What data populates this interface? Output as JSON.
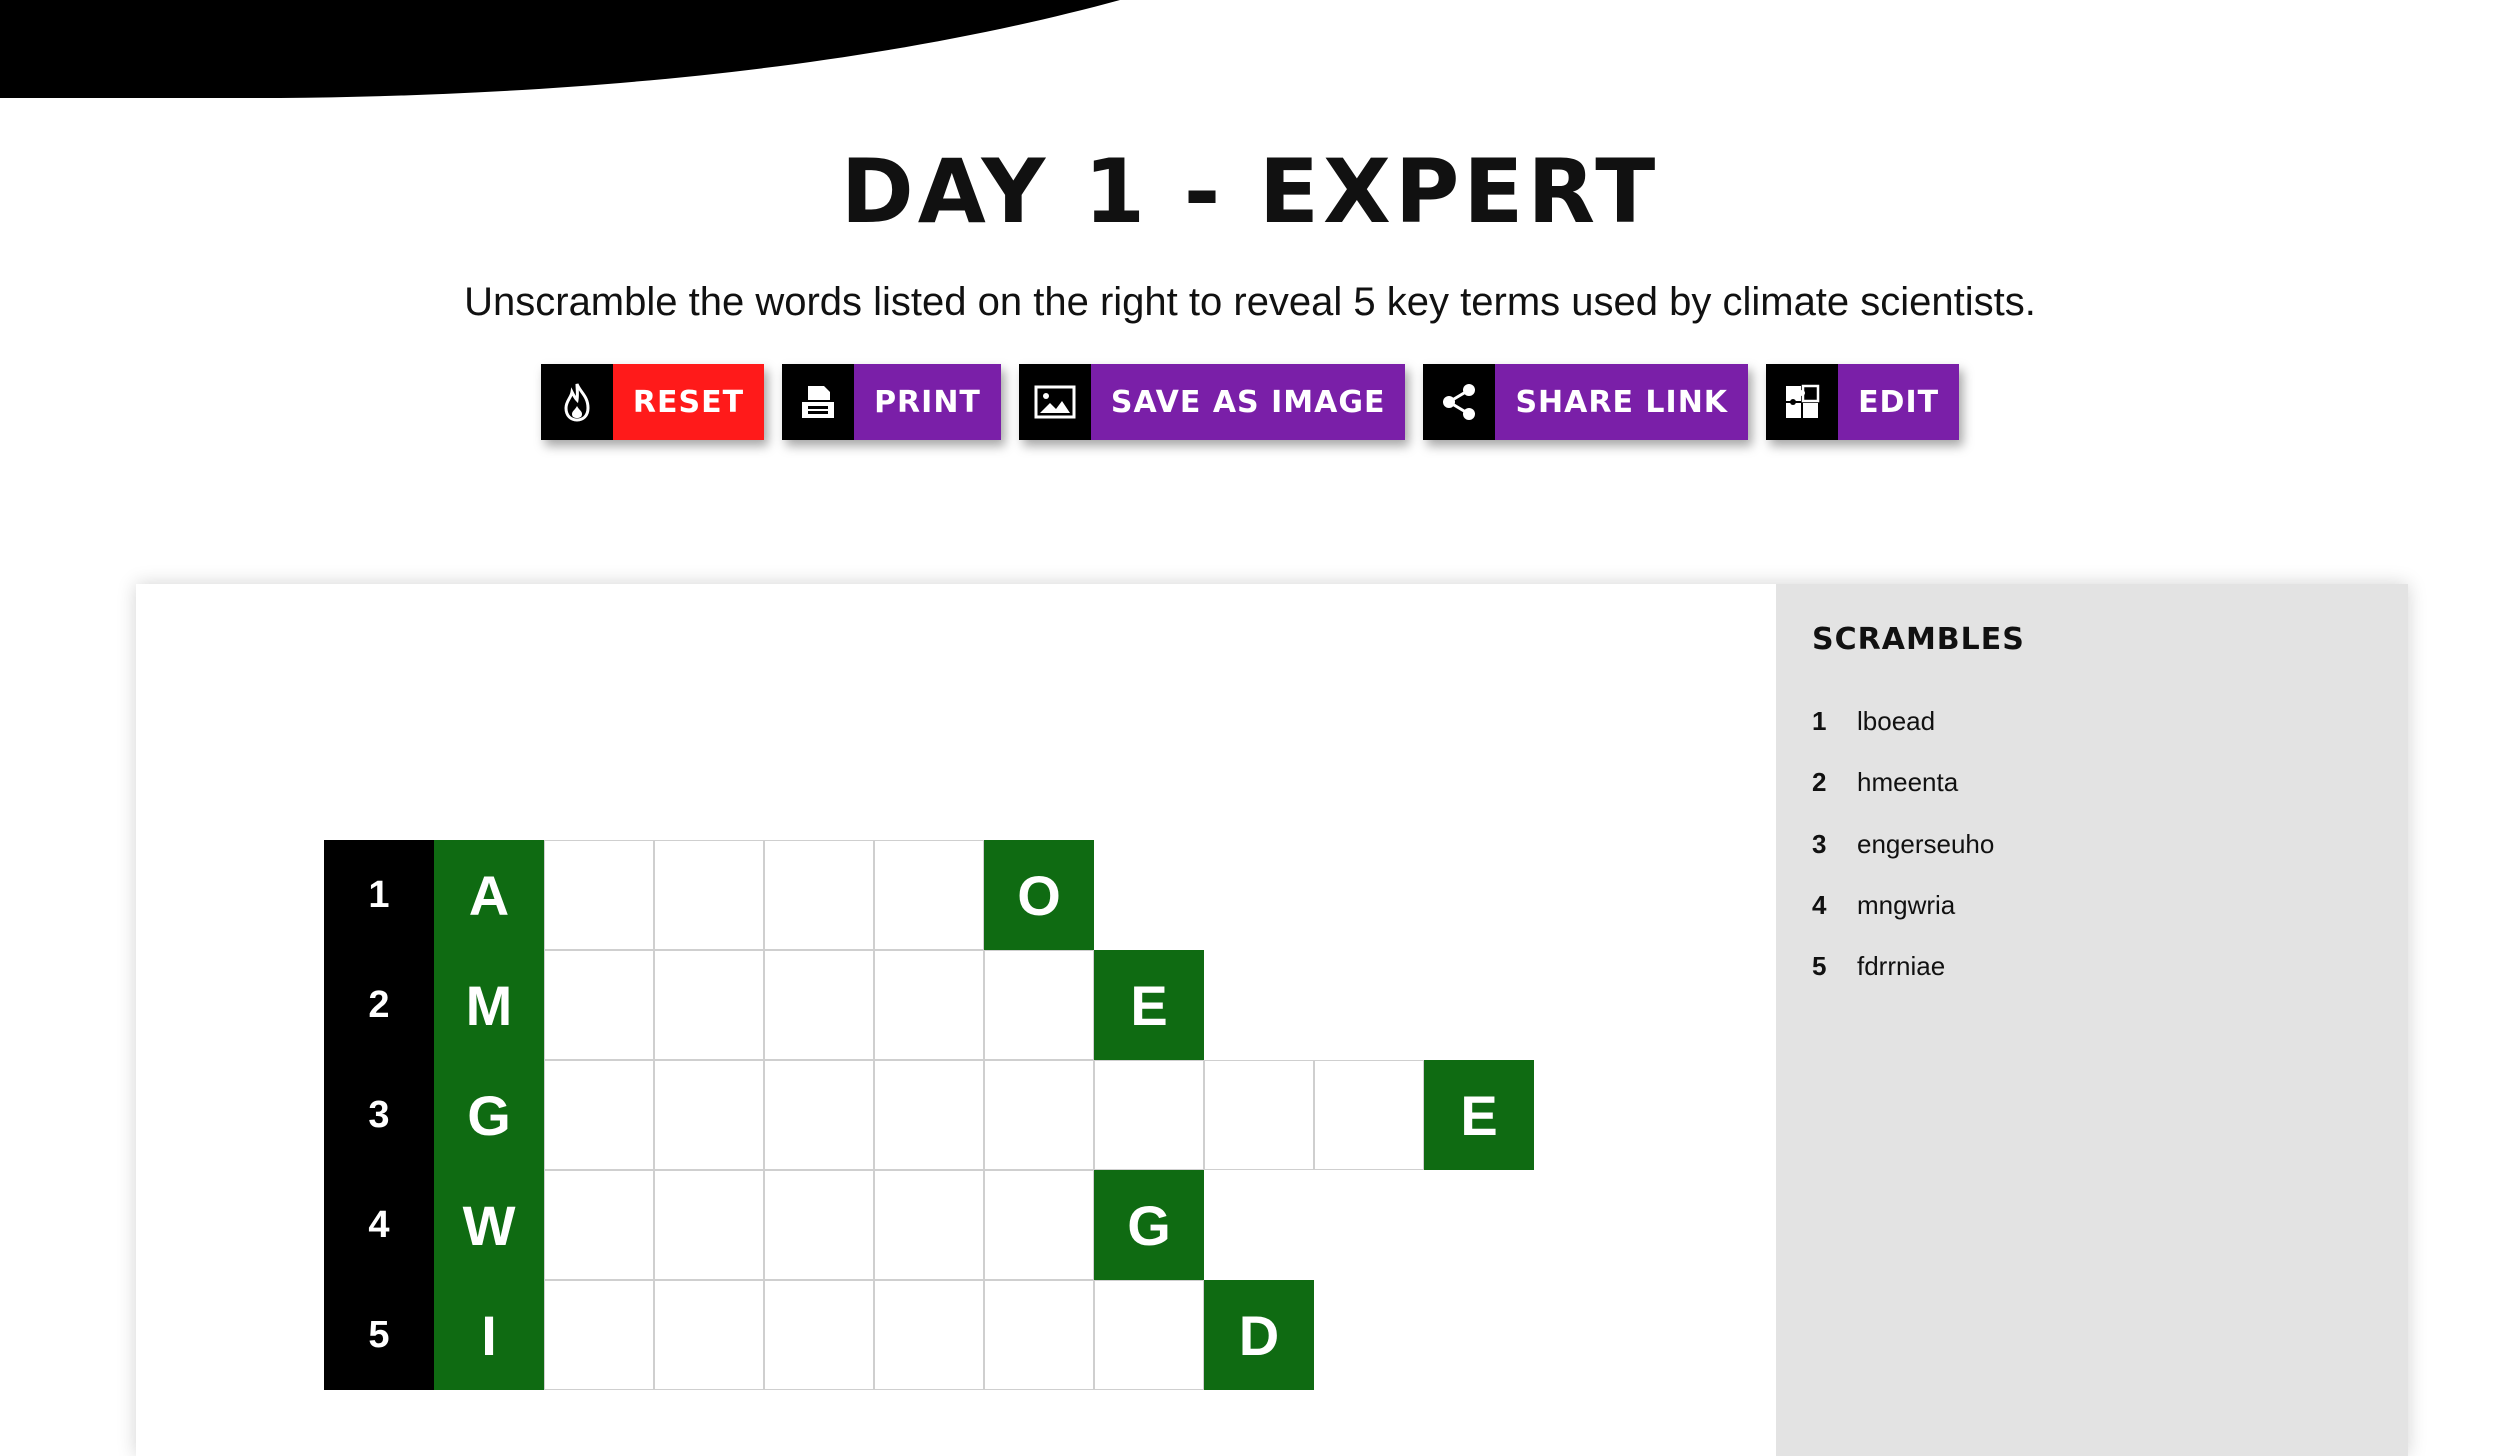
{
  "header": {
    "title": "DAY 1 - EXPERT",
    "subtitle": "Unscramble the words listed on the right to reveal 5 key terms used by climate scientists."
  },
  "toolbar": [
    {
      "label": "RESET",
      "icon": "fire-icon",
      "color": "#ff1a1a"
    },
    {
      "label": "PRINT",
      "icon": "printer-icon",
      "color": "#7a1fa8"
    },
    {
      "label": "SAVE AS IMAGE",
      "icon": "image-icon",
      "color": "#7a1fa8"
    },
    {
      "label": "SHARE LINK",
      "icon": "share-icon",
      "color": "#7a1fa8"
    },
    {
      "label": "EDIT",
      "icon": "puzzle-icon",
      "color": "#7a1fa8"
    }
  ],
  "scrambles": {
    "title": "SCRAMBLES",
    "items": [
      {
        "num": "1",
        "word": "lboead"
      },
      {
        "num": "2",
        "word": "hmeenta"
      },
      {
        "num": "3",
        "word": "engerseuho"
      },
      {
        "num": "4",
        "word": "mngwria"
      },
      {
        "num": "5",
        "word": "fdrrniae"
      }
    ]
  },
  "puzzle": {
    "rows": [
      {
        "num": "1",
        "first": "A",
        "length": 6,
        "highlight_col": 5,
        "highlight_letter": "O"
      },
      {
        "num": "2",
        "first": "M",
        "length": 7,
        "highlight_col": 6,
        "highlight_letter": "E"
      },
      {
        "num": "3",
        "first": "G",
        "length": 10,
        "highlight_col": 9,
        "highlight_letter": "E"
      },
      {
        "num": "4",
        "first": "W",
        "length": 7,
        "highlight_col": 6,
        "highlight_letter": "G"
      },
      {
        "num": "5",
        "first": "I",
        "length": 8,
        "highlight_col": 7,
        "highlight_letter": "D"
      }
    ]
  },
  "colors": {
    "accent_green": "#0f6b12",
    "reset_red": "#ff1a1a",
    "button_purple": "#7a1fa8"
  }
}
